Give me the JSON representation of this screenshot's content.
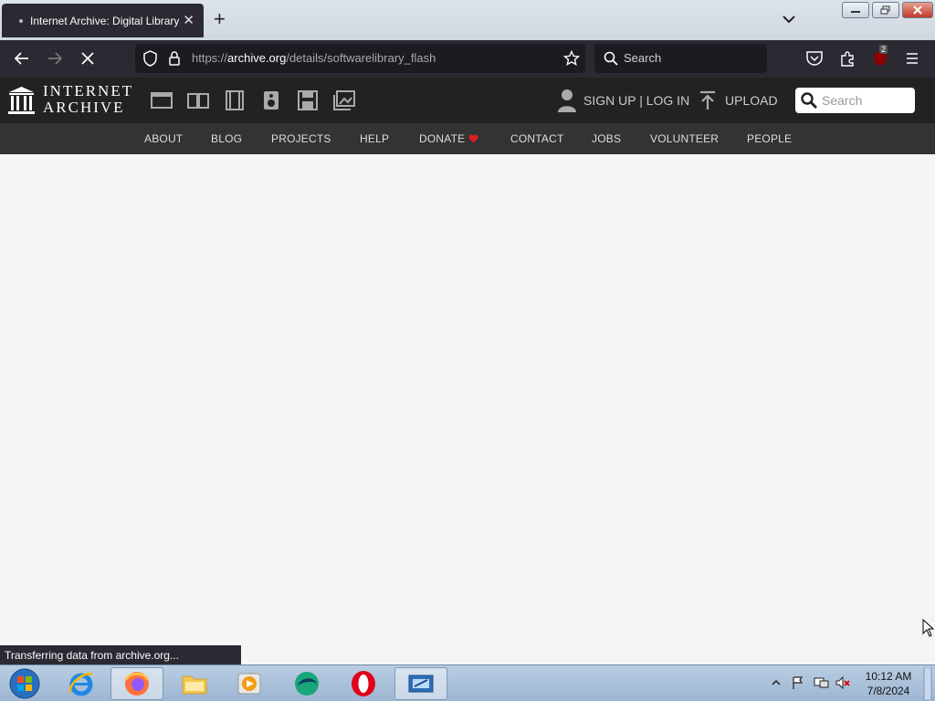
{
  "browser": {
    "tab_title": "Internet Archive: Digital Library",
    "tab_close": "✕",
    "new_tab": "+",
    "url_host": "archive.org",
    "url_prefix": "https://",
    "url_path": "/details/softwarelibrary_flash",
    "search_placeholder": "Search",
    "extension_badge": "2",
    "status_text": "Transferring data from archive.org..."
  },
  "site": {
    "logo_line1": "INTERNET",
    "logo_line2": "ARCHIVE",
    "media_icons": [
      "web-icon",
      "texts-icon",
      "video-icon",
      "audio-icon",
      "software-icon",
      "images-icon"
    ],
    "signup_label": "SIGN UP | LOG IN",
    "upload_label": "UPLOAD",
    "search_placeholder": "Search",
    "nav": [
      "ABOUT",
      "BLOG",
      "PROJECTS",
      "HELP",
      "DONATE",
      "CONTACT",
      "JOBS",
      "VOLUNTEER",
      "PEOPLE"
    ],
    "donate_heart_color": "#e11d1d"
  },
  "taskbar": {
    "time": "10:12 AM",
    "date": "7/8/2024",
    "apps": [
      "start-orb-icon",
      "internet-explorer-icon",
      "firefox-icon",
      "file-explorer-icon",
      "media-player-icon",
      "browser-app-icon",
      "opera-icon",
      "app-window-icon"
    ]
  },
  "colors": {
    "browser_dark": "#2b2a33",
    "ia_header": "#222222",
    "ia_nav": "#333333",
    "page_bg": "#f5f5f5"
  }
}
